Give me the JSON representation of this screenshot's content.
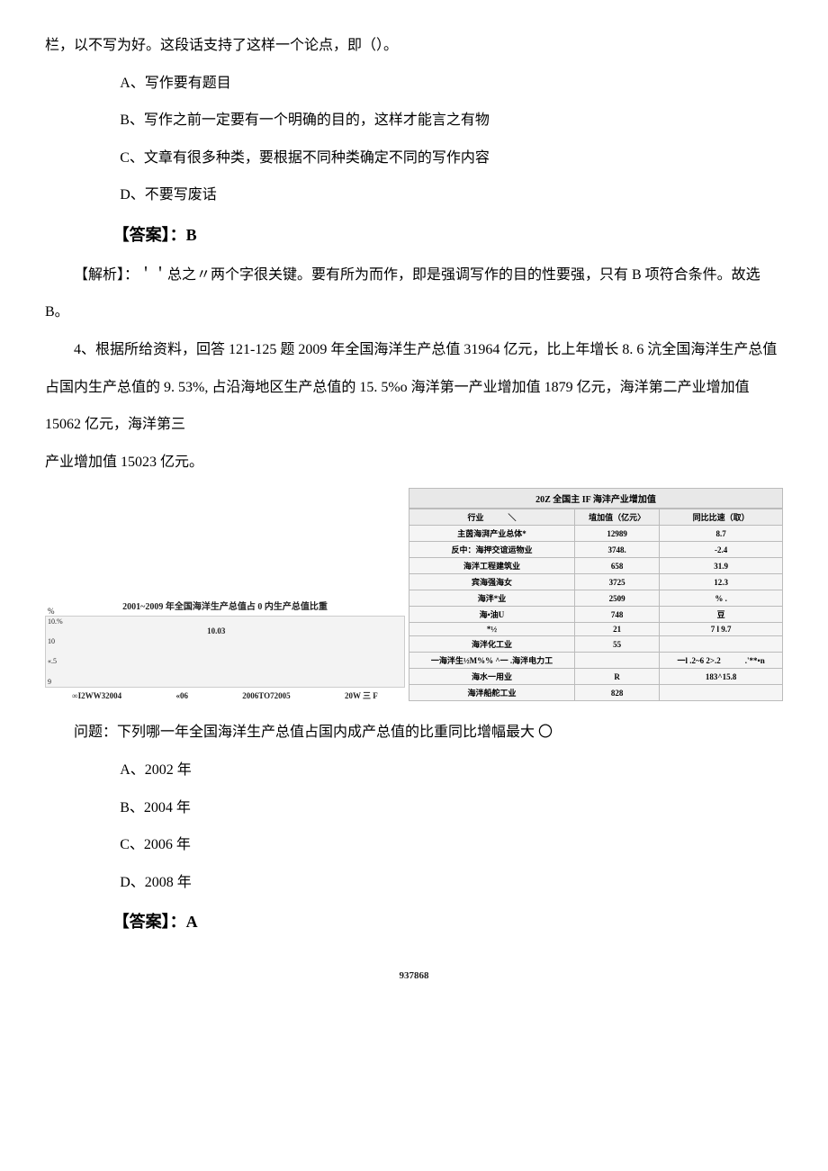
{
  "intro_line": "栏，以不写为好。这段话支持了这样一个论点，即（）。",
  "q3": {
    "opts": {
      "a": "A、写作要有题目",
      "b": "B、写作之前一定要有一个明确的目的，这样才能言之有物",
      "c": "C、文章有很多种类，要根据不同种类确定不同的写作内容",
      "d": "D、不要写废话"
    },
    "answer_label": "【答案】：B",
    "analysis": "【解析】：＇＇总之〃两个字很关键。要有所为而作，即是强调写作的目的性要强，只有 B 项符合条件。故选 B。"
  },
  "q4": {
    "stem1": "4、根据所给资料，回答 121-125 题 2009 年全国海洋生产总值 31964 亿元，比上年增长 8. 6 沆全国海洋生产总值占国内生产总值的 9. 53%, 占沿海地区生产总值的 15. 5%o 海洋第一产业增加值 1879 亿元，海洋第二产业增加值 15062 亿元，海洋第三",
    "stem2": "产业增加值 15023 亿元。",
    "question": "问题：下列哪一年全国海洋生产总值占国内成产总值的比重同比增幅最大 〇",
    "opts": {
      "a": "A、2002 年",
      "b": "B、2004 年",
      "c": "C、2006 年",
      "d": "D、2008 年"
    },
    "answer_label": "【答案】：A"
  },
  "chart_data": {
    "type": "bar",
    "title": "2001~2009 年全国海洋生产总值占 0 内生产总值比重",
    "y_unit": "%",
    "y_ticks": [
      "10.%",
      "10",
      "«.5",
      "9"
    ],
    "bar_label": "10.03",
    "x_labels": [
      "∞I2WW32004",
      "«06",
      "2006TO72005",
      "20W 三 F"
    ]
  },
  "table": {
    "caption": "20Z 全国主 IF 海沣产业增加值",
    "head": [
      "行业　　　＼",
      "埴加值（亿元〉",
      "同比比速（取）"
    ],
    "rows": [
      [
        "主茵海湃产业总体*",
        "12989",
        "8.7"
      ],
      [
        "反中：海押交谊运物业",
        "3748.",
        "-2.4"
      ],
      [
        "海泮工程建筑业",
        "658",
        "31.9"
      ],
      [
        "宾海强海女",
        "3725",
        "12.3"
      ],
      [
        "海泮*业",
        "2509",
        "% ."
      ],
      [
        "海•油U",
        "748",
        "豆"
      ],
      [
        "*½",
        "21",
        "7 l  9.7"
      ],
      [
        "海泮化工业",
        "55",
        ""
      ],
      [
        "一海泮生½M%% ^一 .海泮电力工",
        "",
        "一l .2~6\n2>.2　　　.'**•n"
      ],
      [
        "海水一用业",
        "R",
        "183^15.8"
      ],
      [
        "海泮船舵工业",
        "828",
        ""
      ]
    ]
  },
  "page_number": "937868"
}
